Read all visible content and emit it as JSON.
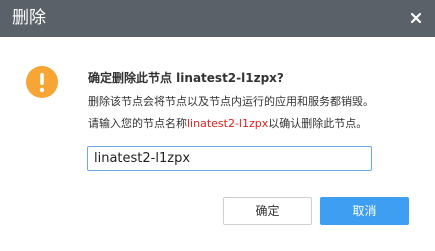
{
  "dialog": {
    "title": "删除",
    "question": "确定删除此节点 linatest2-l1zpx?",
    "description": "删除该节点会将节点以及节点内运行的应用和服务都销毁。",
    "prompt_before": "请输入您的节点名称",
    "prompt_node_name": "linatest2-l1zpx",
    "prompt_after": "以确认删除此节点。",
    "input_value": "linatest2-l1zpx",
    "confirm_label": "确定",
    "cancel_label": "取消",
    "icons": {
      "warning": "warning-icon",
      "close": "close-icon"
    },
    "colors": {
      "header": "#5b6168",
      "warning": "#f7a535",
      "primary": "#3d9ef2",
      "danger_text": "#e02020"
    }
  }
}
